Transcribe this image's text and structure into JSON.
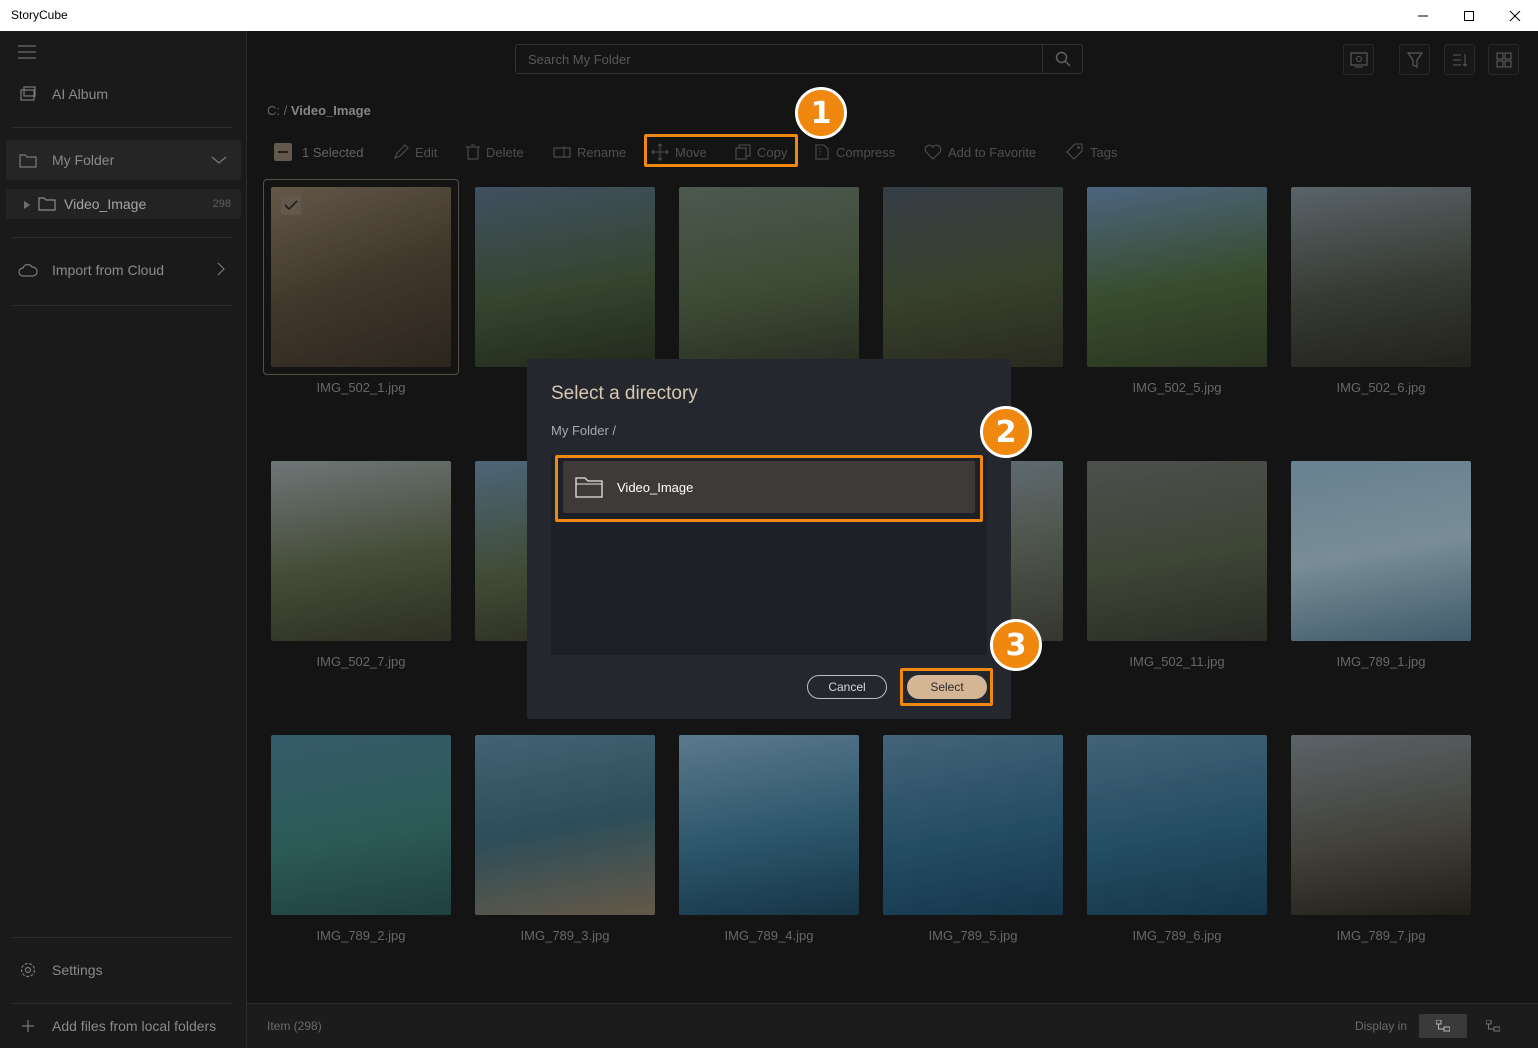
{
  "window": {
    "title": "StoryCube"
  },
  "sidebar": {
    "ai_album": "AI Album",
    "my_folder": "My Folder",
    "folder_item": {
      "label": "Video_Image",
      "count": "298"
    },
    "import_cloud": "Import from Cloud",
    "settings": "Settings",
    "add_files": "Add files from local folders"
  },
  "search": {
    "placeholder": "Search My Folder"
  },
  "breadcrumb": {
    "root": "C: /",
    "current": "Video_Image"
  },
  "toolbar": {
    "selected": "1 Selected",
    "edit": "Edit",
    "delete": "Delete",
    "rename": "Rename",
    "move": "Move",
    "copy": "Copy",
    "compress": "Compress",
    "favorite": "Add to Favorite",
    "tags": "Tags"
  },
  "photos": [
    "IMG_502_1.jpg",
    "I",
    "",
    "g",
    "IMG_502_5.jpg",
    "IMG_502_6.jpg",
    "IMG_502_7.jpg",
    "I",
    "",
    "",
    "IMG_502_11.jpg",
    "IMG_789_1.jpg",
    "IMG_789_2.jpg",
    "IMG_789_3.jpg",
    "IMG_789_4.jpg",
    "IMG_789_5.jpg",
    "IMG_789_6.jpg",
    "IMG_789_7.jpg"
  ],
  "dialog": {
    "title": "Select a directory",
    "path": "My Folder  /",
    "item": "Video_Image",
    "cancel": "Cancel",
    "select": "Select"
  },
  "badges": [
    "1",
    "2",
    "3"
  ],
  "status": {
    "items": "Item (298)",
    "display_in": "Display in"
  },
  "colors": {
    "accent": "#f0870f",
    "select_button": "#d4b594",
    "dialog_title": "#d8c7b2"
  }
}
